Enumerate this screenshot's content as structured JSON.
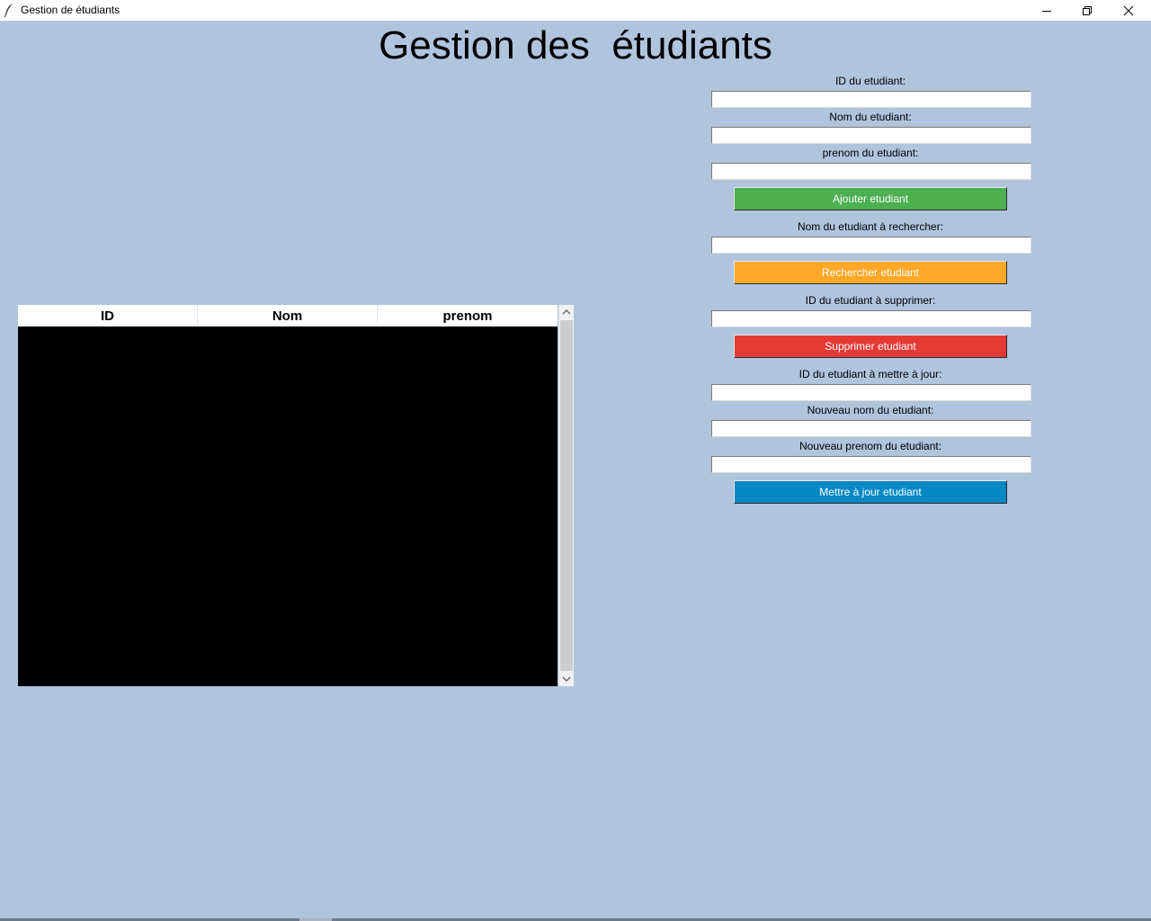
{
  "window": {
    "title": "Gestion de étudiants",
    "icon": "feather-icon",
    "background": "#b0c4de"
  },
  "heading": "Gestion des  étudiants",
  "form": {
    "id_label": "ID du etudiant:",
    "id_value": "",
    "nom_label": "Nom du etudiant:",
    "nom_value": "",
    "prenom_label": "prenom du etudiant:",
    "prenom_value": "",
    "add_button": "Ajouter etudiant",
    "search_label": "Nom du etudiant à rechercher:",
    "search_value": "",
    "search_button": "Rechercher etudiant",
    "delete_label": "ID du etudiant à supprimer:",
    "delete_value": "",
    "delete_button": "Supprimer etudiant",
    "update_id_label": "ID du etudiant à mettre à jour:",
    "update_id_value": "",
    "update_nom_label": "Nouveau nom du etudiant:",
    "update_nom_value": "",
    "update_prenom_label": "Nouveau prenom du etudiant:",
    "update_prenom_value": "",
    "update_button": "Mettre à jour etudiant"
  },
  "colors": {
    "add": "#4caf50",
    "search": "#ffa726",
    "delete": "#e53935",
    "update": "#0288c5",
    "table_body": "#000000"
  },
  "table": {
    "columns": [
      "ID",
      "Nom",
      "prenom"
    ],
    "rows": []
  }
}
